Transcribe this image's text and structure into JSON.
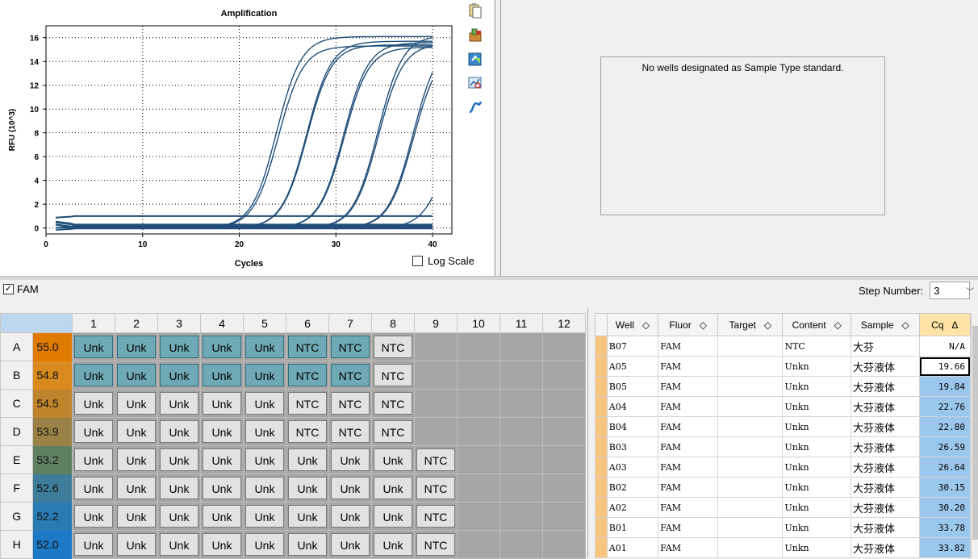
{
  "chart": {
    "title": "Amplification",
    "ylabel": "RFU (10^3)",
    "xlabel": "Cycles",
    "log_scale_label": "Log Scale",
    "log_scale_checked": false,
    "curve_color": "#1f4e79"
  },
  "chart_data": {
    "type": "line",
    "title": "Amplification",
    "xlabel": "Cycles",
    "ylabel": "RFU (10^3)",
    "xlim": [
      0,
      42
    ],
    "ylim": [
      -0.5,
      17
    ],
    "xticks": [
      0,
      10,
      20,
      30,
      40
    ],
    "yticks": [
      0,
      2,
      4,
      6,
      8,
      10,
      12,
      14,
      16
    ],
    "grid": true,
    "series": [
      {
        "cq": 19.66,
        "plateau": 16.1
      },
      {
        "cq": 19.84,
        "plateau": 15.3
      },
      {
        "cq": 22.76,
        "plateau": 15.7
      },
      {
        "cq": 22.8,
        "plateau": 15.4
      },
      {
        "cq": 26.59,
        "plateau": 15.6
      },
      {
        "cq": 26.64,
        "plateau": 15.2
      },
      {
        "cq": 30.15,
        "plateau": 16.2
      },
      {
        "cq": 30.2,
        "plateau": 15.5
      },
      {
        "cq": 33.78,
        "plateau": 15.8
      },
      {
        "cq": 33.82,
        "plateau": 15.1
      },
      {
        "cq": 37.5,
        "plateau": 12.5
      }
    ],
    "flat_lines": [
      1.0,
      0.3,
      0.15,
      0.05,
      -0.05,
      0.0,
      0.1,
      0.2
    ]
  },
  "right_panel": {
    "message": "No wells designated as Sample Type standard."
  },
  "fluor": {
    "label": "FAM",
    "checked": true
  },
  "step": {
    "label": "Step Number:",
    "value": "3"
  },
  "plate": {
    "columns": [
      "1",
      "2",
      "3",
      "4",
      "5",
      "6",
      "7",
      "8",
      "9",
      "10",
      "11",
      "12"
    ],
    "rows": [
      {
        "label": "A",
        "temp": "55.0",
        "color": "#e07b00",
        "wells": [
          [
            "Unk",
            "t"
          ],
          [
            "Unk",
            "t"
          ],
          [
            "Unk",
            "t"
          ],
          [
            "Unk",
            "t"
          ],
          [
            "Unk",
            "t"
          ],
          [
            "NTC",
            "t"
          ],
          [
            "NTC",
            "t"
          ],
          [
            "NTC",
            "g"
          ],
          [
            "",
            ""
          ],
          [
            "",
            ""
          ],
          [
            "",
            ""
          ],
          [
            "",
            ""
          ]
        ]
      },
      {
        "label": "B",
        "temp": "54.8",
        "color": "#d88a1e",
        "wells": [
          [
            "Unk",
            "t"
          ],
          [
            "Unk",
            "t"
          ],
          [
            "Unk",
            "t"
          ],
          [
            "Unk",
            "t"
          ],
          [
            "Unk",
            "t"
          ],
          [
            "NTC",
            "t"
          ],
          [
            "NTC",
            "t"
          ],
          [
            "NTC",
            "g"
          ],
          [
            "",
            ""
          ],
          [
            "",
            ""
          ],
          [
            "",
            ""
          ],
          [
            "",
            ""
          ]
        ]
      },
      {
        "label": "C",
        "temp": "54.5",
        "color": "#c0852c",
        "wells": [
          [
            "Unk",
            "g"
          ],
          [
            "Unk",
            "g"
          ],
          [
            "Unk",
            "g"
          ],
          [
            "Unk",
            "g"
          ],
          [
            "Unk",
            "g"
          ],
          [
            "NTC",
            "g"
          ],
          [
            "NTC",
            "g"
          ],
          [
            "NTC",
            "g"
          ],
          [
            "",
            ""
          ],
          [
            "",
            ""
          ],
          [
            "",
            ""
          ],
          [
            "",
            ""
          ]
        ]
      },
      {
        "label": "D",
        "temp": "53.9",
        "color": "#9a8246",
        "wells": [
          [
            "Unk",
            "g"
          ],
          [
            "Unk",
            "g"
          ],
          [
            "Unk",
            "g"
          ],
          [
            "Unk",
            "g"
          ],
          [
            "Unk",
            "g"
          ],
          [
            "NTC",
            "g"
          ],
          [
            "NTC",
            "g"
          ],
          [
            "NTC",
            "g"
          ],
          [
            "",
            ""
          ],
          [
            "",
            ""
          ],
          [
            "",
            ""
          ],
          [
            "",
            ""
          ]
        ]
      },
      {
        "label": "E",
        "temp": "53.2",
        "color": "#5f8060",
        "wells": [
          [
            "Unk",
            "g"
          ],
          [
            "Unk",
            "g"
          ],
          [
            "Unk",
            "g"
          ],
          [
            "Unk",
            "g"
          ],
          [
            "Unk",
            "g"
          ],
          [
            "Unk",
            "g"
          ],
          [
            "Unk",
            "g"
          ],
          [
            "Unk",
            "g"
          ],
          [
            "NTC",
            "g"
          ],
          [
            "",
            ""
          ],
          [
            "",
            ""
          ],
          [
            "",
            ""
          ]
        ]
      },
      {
        "label": "F",
        "temp": "52.6",
        "color": "#3d7d9a",
        "wells": [
          [
            "Unk",
            "g"
          ],
          [
            "Unk",
            "g"
          ],
          [
            "Unk",
            "g"
          ],
          [
            "Unk",
            "g"
          ],
          [
            "Unk",
            "g"
          ],
          [
            "Unk",
            "g"
          ],
          [
            "Unk",
            "g"
          ],
          [
            "Unk",
            "g"
          ],
          [
            "NTC",
            "g"
          ],
          [
            "",
            ""
          ],
          [
            "",
            ""
          ],
          [
            "",
            ""
          ]
        ]
      },
      {
        "label": "G",
        "temp": "52.2",
        "color": "#2a7bb4",
        "wells": [
          [
            "Unk",
            "g"
          ],
          [
            "Unk",
            "g"
          ],
          [
            "Unk",
            "g"
          ],
          [
            "Unk",
            "g"
          ],
          [
            "Unk",
            "g"
          ],
          [
            "Unk",
            "g"
          ],
          [
            "Unk",
            "g"
          ],
          [
            "Unk",
            "g"
          ],
          [
            "NTC",
            "g"
          ],
          [
            "",
            ""
          ],
          [
            "",
            ""
          ],
          [
            "",
            ""
          ]
        ]
      },
      {
        "label": "H",
        "temp": "52.0",
        "color": "#1d78c6",
        "wells": [
          [
            "Unk",
            "g"
          ],
          [
            "Unk",
            "g"
          ],
          [
            "Unk",
            "g"
          ],
          [
            "Unk",
            "g"
          ],
          [
            "Unk",
            "g"
          ],
          [
            "Unk",
            "g"
          ],
          [
            "Unk",
            "g"
          ],
          [
            "Unk",
            "g"
          ],
          [
            "NTC",
            "g"
          ],
          [
            "",
            ""
          ],
          [
            "",
            ""
          ],
          [
            "",
            ""
          ]
        ]
      }
    ]
  },
  "results": {
    "columns": [
      "Well",
      "Fluor",
      "Target",
      "Content",
      "Sample",
      "Cq"
    ],
    "sort_indicator": "◇",
    "sorted_indicator": "Δ",
    "rows": [
      {
        "well": "B07",
        "fluor": "FAM",
        "target": "",
        "content": "NTC",
        "sample": "大芬",
        "cq": "N/A"
      },
      {
        "well": "A05",
        "fluor": "FAM",
        "target": "",
        "content": "Unkn",
        "sample": "大芬液体",
        "cq": "19.66"
      },
      {
        "well": "B05",
        "fluor": "FAM",
        "target": "",
        "content": "Unkn",
        "sample": "大芬液体",
        "cq": "19.84"
      },
      {
        "well": "A04",
        "fluor": "FAM",
        "target": "",
        "content": "Unkn",
        "sample": "大芬液体",
        "cq": "22.76"
      },
      {
        "well": "B04",
        "fluor": "FAM",
        "target": "",
        "content": "Unkn",
        "sample": "大芬液体",
        "cq": "22.80"
      },
      {
        "well": "B03",
        "fluor": "FAM",
        "target": "",
        "content": "Unkn",
        "sample": "大芬液体",
        "cq": "26.59"
      },
      {
        "well": "A03",
        "fluor": "FAM",
        "target": "",
        "content": "Unkn",
        "sample": "大芬液体",
        "cq": "26.64"
      },
      {
        "well": "B02",
        "fluor": "FAM",
        "target": "",
        "content": "Unkn",
        "sample": "大芬液体",
        "cq": "30.15"
      },
      {
        "well": "A02",
        "fluor": "FAM",
        "target": "",
        "content": "Unkn",
        "sample": "大芬液体",
        "cq": "30.20"
      },
      {
        "well": "B01",
        "fluor": "FAM",
        "target": "",
        "content": "Unkn",
        "sample": "大芬液体",
        "cq": "33.78"
      },
      {
        "well": "A01",
        "fluor": "FAM",
        "target": "",
        "content": "Unkn",
        "sample": "大芬液体",
        "cq": "33.82"
      }
    ]
  },
  "toolbar": {
    "icons": [
      "copy-icon",
      "export-icon",
      "refresh-icon",
      "zoom-chart-icon",
      "curve-settings-icon"
    ]
  }
}
